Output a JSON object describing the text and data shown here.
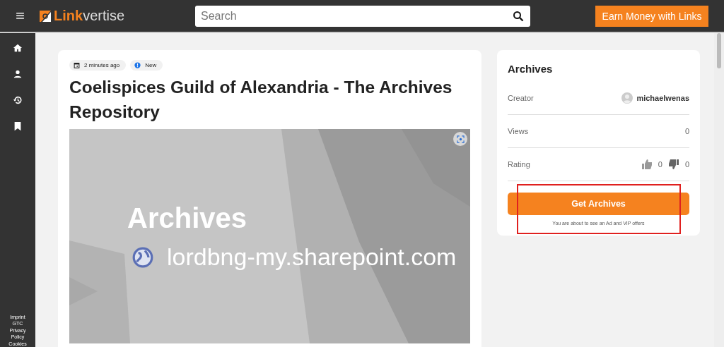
{
  "header": {
    "logo": {
      "part_1": "Link",
      "part_2": "vertise"
    },
    "search": {
      "placeholder": "Search"
    },
    "cta": "Earn Money with Links"
  },
  "sidebar": {
    "footer_links": [
      "Imprint",
      "GTC",
      "Privacy Policy",
      "Cookies"
    ]
  },
  "post": {
    "chips": [
      {
        "kind": "date",
        "label": "2 minutes ago"
      },
      {
        "kind": "status",
        "label": "New"
      }
    ],
    "title": "Coelispices Guild of Alexandria - The Archives Repository",
    "preview": {
      "title": "Archives",
      "domain": "lordbng-my.sharepoint.com"
    }
  },
  "info": {
    "title": "Archives",
    "creator_label": "Creator",
    "creator": "michaelwenas",
    "views_label": "Views",
    "views": "0",
    "rating_label": "Rating",
    "likes": "0",
    "dislikes": "0",
    "button": "Get Archives",
    "note": "You are about to see an Ad and VIP offers"
  }
}
